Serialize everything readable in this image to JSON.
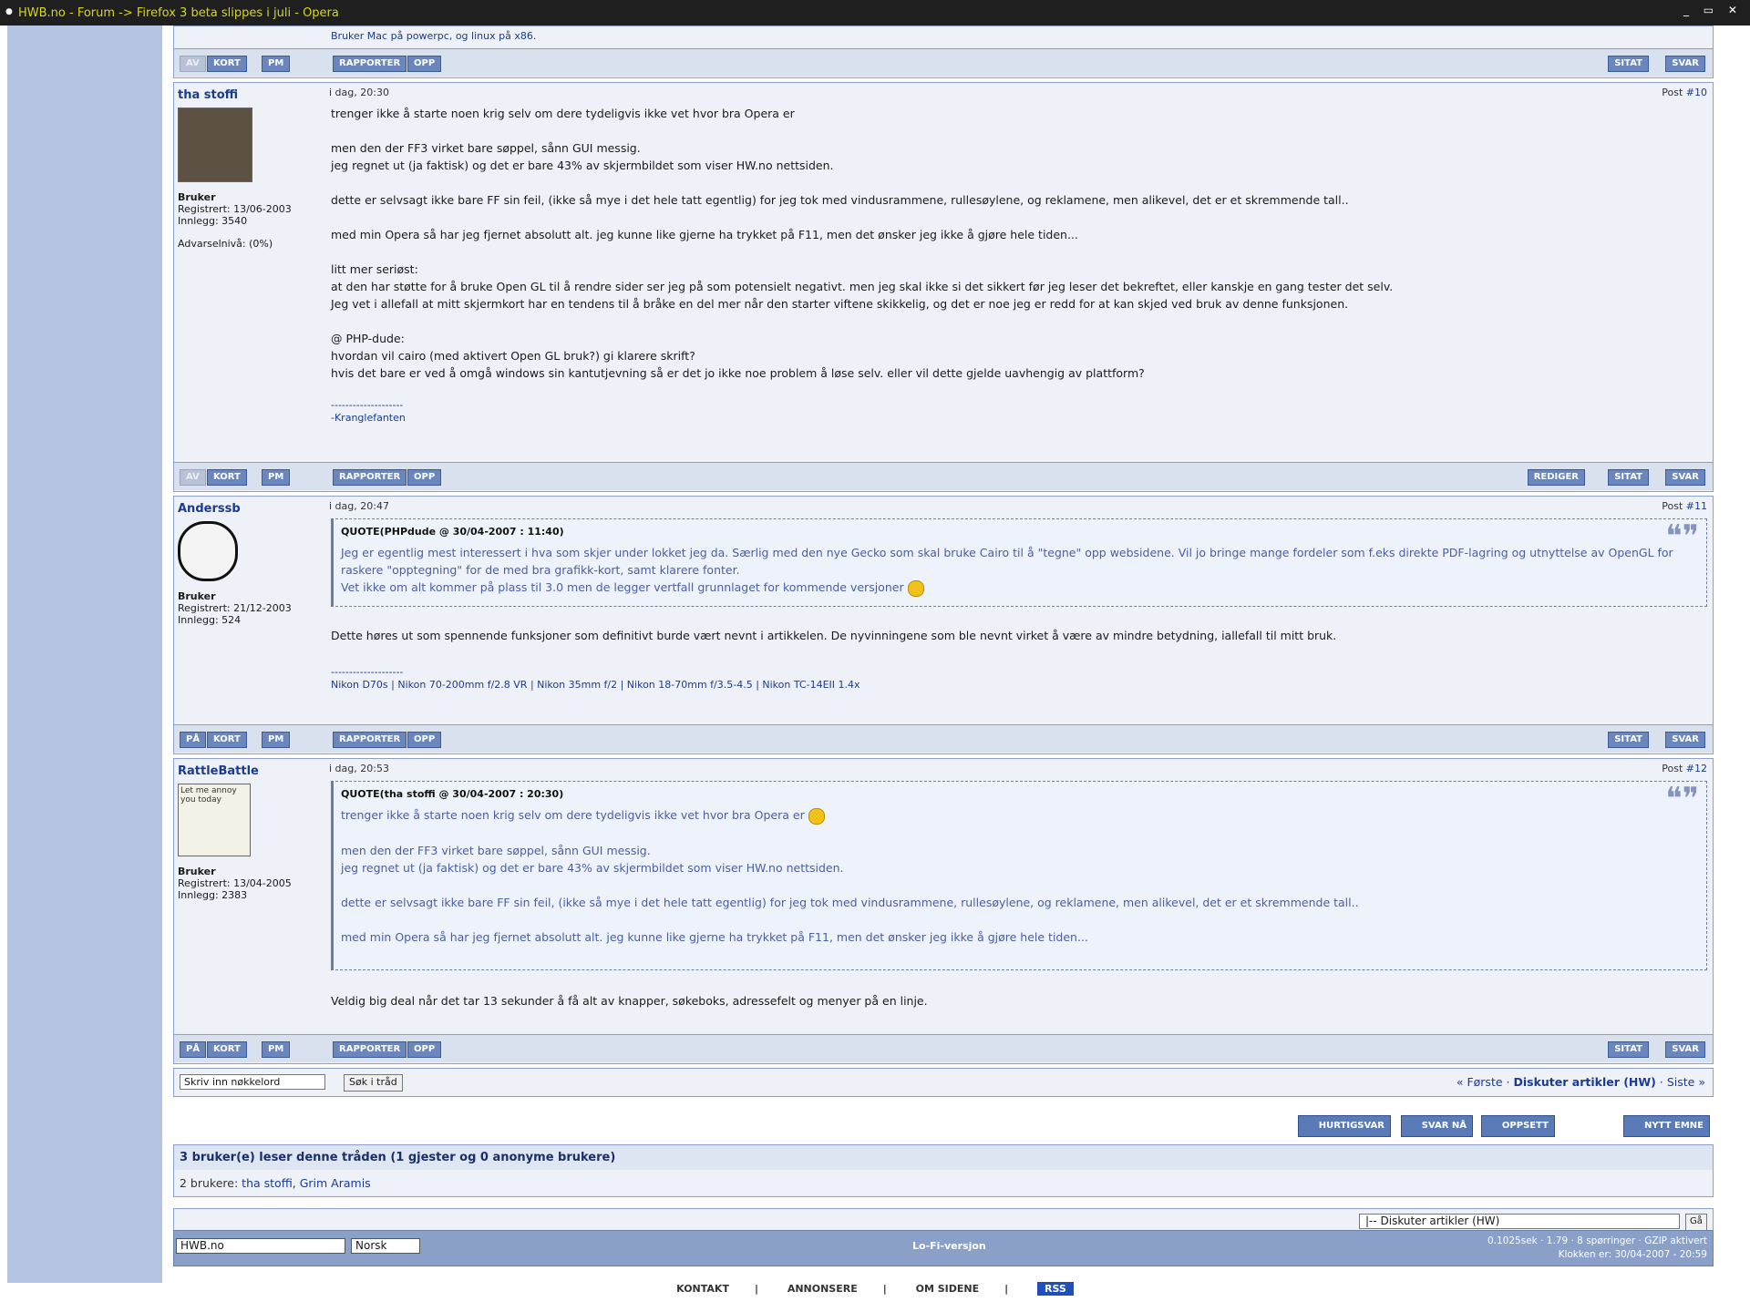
{
  "window": {
    "title": "HWB.no - Forum -> Firefox 3 beta slippes i juli - Opera",
    "controls": "_ ▭ ✕"
  },
  "top": {
    "sig": "Bruker Mac på powerpc, og linux på x86.",
    "bar": {
      "av": "AV",
      "kort": "KORT",
      "pm": "PM",
      "rapporter": "RAPPORTER",
      "opp": "OPP",
      "sitat": "SITAT",
      "svar": "SVAR"
    }
  },
  "posts": [
    {
      "user": "tha stoffi",
      "role": "Bruker",
      "registered": "Registrert: 13/06-2003",
      "posts_count": "Innlegg: 3540",
      "warn": "Advarselnivå: (0%)",
      "time": "i dag, 20:30",
      "post_label": "Post",
      "post_num": "#10",
      "lines": [
        "trenger ikke å starte noen krig selv om dere tydeligvis ikke vet hvor bra Opera er",
        "",
        "men den der FF3 virket bare søppel, sånn GUI messig.",
        "jeg regnet ut (ja faktisk) og det er bare 43% av skjermbildet som viser HW.no nettsiden.",
        "",
        "dette er selvsagt ikke bare FF sin feil, (ikke så mye i det hele tatt egentlig) for jeg tok med vindusrammene, rullesøylene, og reklamene, men alikevel, det er et skremmende tall..",
        "",
        "med min Opera så har jeg fjernet absolutt alt. jeg kunne like gjerne ha trykket på F11, men det ønsker jeg ikke å gjøre hele tiden...",
        "",
        "litt mer seriøst:",
        "at den har støtte for å bruke Open GL til å rendre sider ser jeg på som potensielt negativt. men jeg skal ikke si det sikkert før jeg leser det bekreftet, eller kanskje en gang tester det selv.",
        "Jeg vet i allefall at mitt skjermkort har en tendens til å bråke en del mer når den starter viftene skikkelig, og det er noe jeg er redd for at kan skjed ved bruk av denne funksjonen.",
        "",
        "@ PHP-dude:",
        "hvordan vil cairo (med aktivert Open GL bruk?) gi klarere skrift?",
        "hvis det bare er ved å omgå windows sin kantutjevning så er det jo ikke noe problem å løse selv. eller vil dette gjelde uavhengig av plattform?"
      ],
      "sig_line": "--------------------",
      "sig": "-Kranglefanten",
      "bar": {
        "av": "AV",
        "kort": "KORT",
        "pm": "PM",
        "rapporter": "RAPPORTER",
        "opp": "OPP",
        "rediger": "REDIGER",
        "sitat": "SITAT",
        "svar": "SVAR"
      }
    },
    {
      "user": "Anderssb",
      "role": "Bruker",
      "registered": "Registrert: 21/12-2003",
      "posts_count": "Innlegg: 524",
      "time": "i dag, 20:47",
      "post_label": "Post",
      "post_num": "#11",
      "quote_head": "QUOTE(PHPdude @ 30/04-2007 : 11:40)",
      "quote_lines": [
        "Jeg er egentlig mest interessert i hva som skjer under lokket jeg da. Særlig med den nye Gecko som skal bruke Cairo til å \"tegne\" opp websidene. Vil jo bringe mange fordeler som f.eks direkte PDF-lagring og utnyttelse av OpenGL for raskere \"opptegning\" for de med bra grafikk-kort, samt klarere fonter.",
        "Vet ikke om alt kommer på plass til 3.0 men de legger vertfall grunnlaget for kommende versjoner"
      ],
      "lines": [
        "Dette høres ut som spennende funksjoner som definitivt burde vært nevnt i artikkelen. De nyvinningene som ble nevnt virket å være av mindre betydning, iallefall til mitt bruk."
      ],
      "sig_line": "--------------------",
      "sig": "Nikon D70s | Nikon 70-200mm f/2.8 VR | Nikon 35mm f/2 | Nikon 18-70mm f/3.5-4.5 | Nikon TC-14EII 1.4x",
      "bar": {
        "pa": "PÅ",
        "kort": "KORT",
        "pm": "PM",
        "rapporter": "RAPPORTER",
        "opp": "OPP",
        "sitat": "SITAT",
        "svar": "SVAR"
      }
    },
    {
      "user": "RattleBattle",
      "avatar_text": "Let me annoy you today",
      "role": "Bruker",
      "registered": "Registrert: 13/04-2005",
      "posts_count": "Innlegg: 2383",
      "time": "i dag, 20:53",
      "post_label": "Post",
      "post_num": "#12",
      "quote_head": "QUOTE(tha stoffi @ 30/04-2007 : 20:30)",
      "quote_lines": [
        "trenger ikke å starte noen krig selv om dere tydeligvis ikke vet hvor bra Opera er",
        "",
        "men den der FF3 virket bare søppel, sånn GUI messig.",
        "jeg regnet ut (ja faktisk) og det er bare 43% av skjermbildet som viser HW.no nettsiden.",
        "",
        "dette er selvsagt ikke bare FF sin feil, (ikke så mye i det hele tatt egentlig) for jeg tok med vindusrammene, rullesøylene, og reklamene, men alikevel, det er et skremmende tall..",
        "",
        "med min Opera så har jeg fjernet absolutt alt. jeg kunne like gjerne ha trykket på F11, men det ønsker jeg ikke å gjøre hele tiden..."
      ],
      "lines": [
        "Veldig big deal når det tar 13 sekunder å få alt av knapper, søkeboks, adressefelt og menyer på en linje."
      ],
      "bar": {
        "pa": "PÅ",
        "kort": "KORT",
        "pm": "PM",
        "rapporter": "RAPPORTER",
        "opp": "OPP",
        "sitat": "SITAT",
        "svar": "SVAR"
      }
    }
  ],
  "search": {
    "keyword_value": "Skriv inn nøkkelord",
    "button": "Søk i tråd",
    "first": "« Første",
    "current": "Diskuter artikler (HW)",
    "last": "Siste »",
    "sep": "·"
  },
  "actions": {
    "hurtigsvar": "HURTIGSVAR",
    "svar_na": "SVAR NÅ",
    "oppsett": "OPPSETT",
    "nytt_emne": "NYTT EMNE"
  },
  "readers": {
    "head": "3 bruker(e) leser denne tråden (1 gjester og 0 anonyme brukere)",
    "prefix": "2 brukere:",
    "users": [
      "tha stoffi",
      "Grim Aramis"
    ]
  },
  "jump": {
    "value": "|-- Diskuter artikler (HW)",
    "go": "Gå"
  },
  "footer": {
    "site_select": "HWB.no",
    "lang_select": "Norsk",
    "lofi": "Lo-Fi-versjon",
    "stat_time": "0.1025sek",
    "stat_load": "1.79",
    "stat_queries": "8 spørringer",
    "stat_gzip": "GZIP aktivert",
    "clock": "Klokken er: 30/04-2007 - 20:59"
  },
  "links": {
    "kontakt": "KONTAKT",
    "annonsere": "ANNONSERE",
    "om": "OM SIDENE",
    "rss": "RSS",
    "sep": "|"
  }
}
